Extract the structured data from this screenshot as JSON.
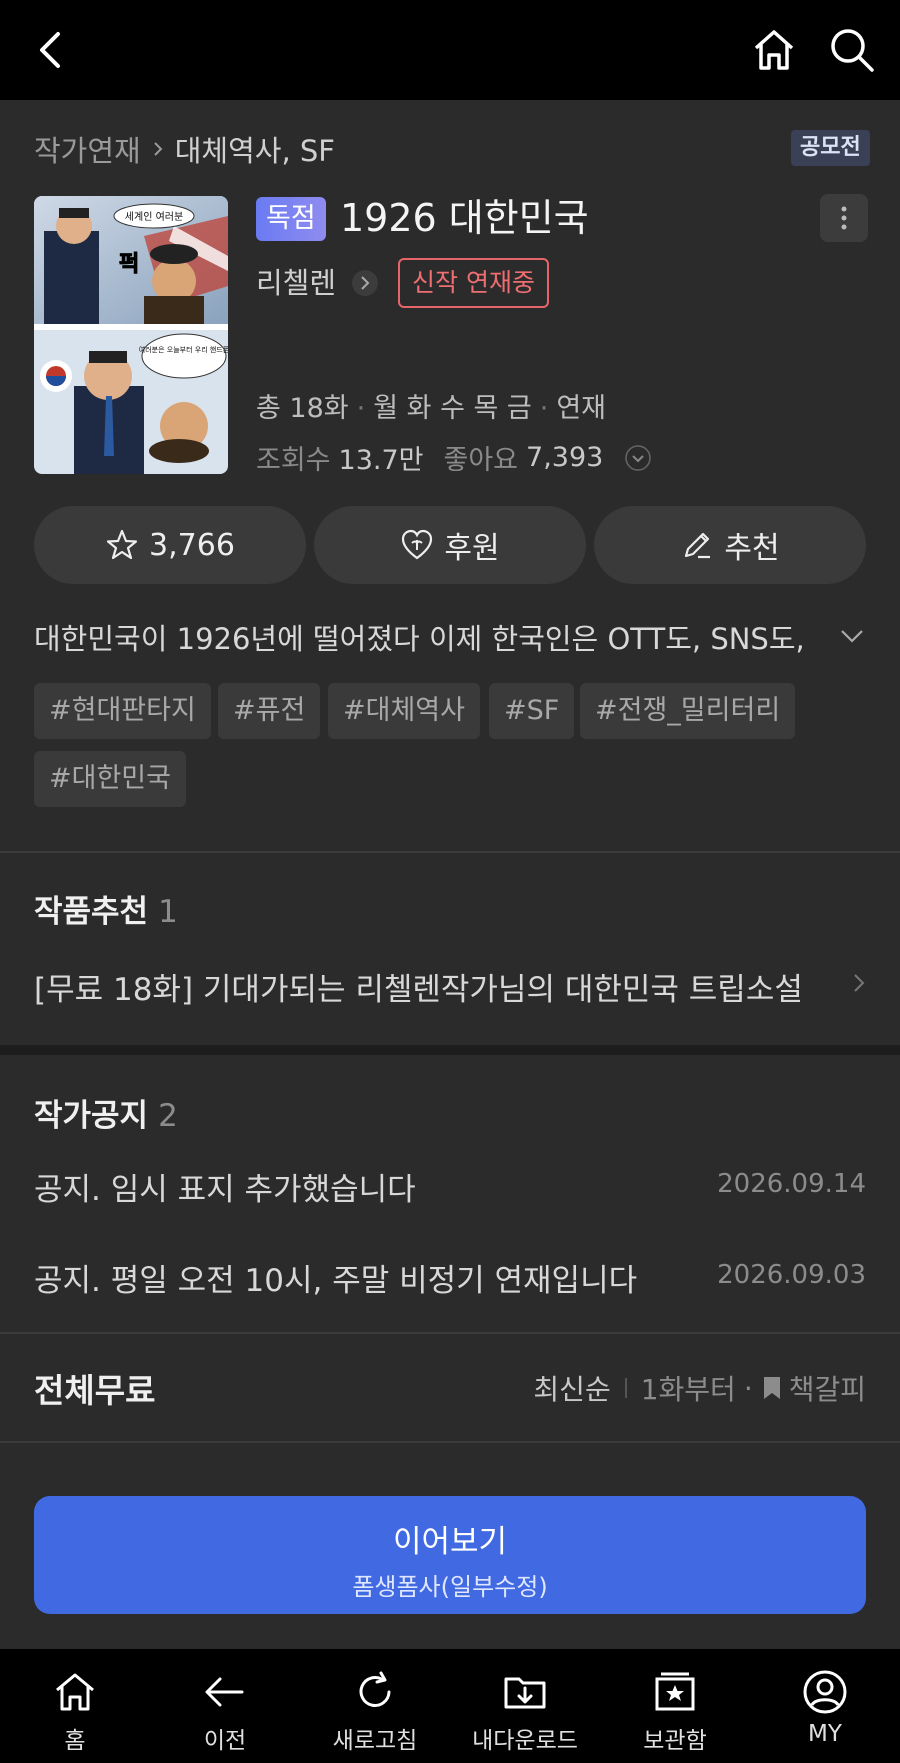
{
  "breadcrumb": {
    "parent": "작가연재",
    "current": "대체역사, SF"
  },
  "contest_badge": "공모전",
  "work": {
    "exclusive_badge": "독점",
    "title": "1926 대한민국",
    "author": "리첼렌",
    "status_tag": "신작 연재중",
    "episodes": "총 18화",
    "schedule": "월 화 수 목 금",
    "serial": "연재",
    "views_label": "조회수",
    "views": "13.7만",
    "likes_label": "좋아요",
    "likes": "7,393"
  },
  "cover_texts": {
    "top_bubble": "세계인 여러분",
    "sfx": "퍽",
    "bottom_bubble": "여러분은 오늘부터 우리 핸드폰 고객이야. 알았어?!"
  },
  "actions": [
    {
      "icon": "star-icon",
      "label": "3,766"
    },
    {
      "icon": "heart-gift-icon",
      "label": "후원"
    },
    {
      "icon": "pencil-icon",
      "label": "추천"
    }
  ],
  "description": "대한민국이 1926년에 떨어졌다 이제 한국인은 OTT도, SNS도, …",
  "tags": [
    "#현대판타지",
    "#퓨전",
    "#대체역사",
    "#SF",
    "#전쟁_밀리터리",
    "#대한민국"
  ],
  "recommend": {
    "title": "작품추천",
    "count": "1",
    "item": "[무료 18화] 기대가되는 리첼렌작가님의 대한민국 트립소설"
  },
  "notices": {
    "title": "작가공지",
    "count": "2",
    "items": [
      {
        "text": "공지. 임시 표지 추가했습니다",
        "date": "2026.09.14"
      },
      {
        "text": "공지. 평일 오전 10시, 주말 비정기 연재입니다",
        "date": "2026.09.03"
      }
    ]
  },
  "episodes_header": {
    "title": "전체무료",
    "sort_latest": "최신순",
    "sort_first": "1화부터",
    "bookmark": "책갈피"
  },
  "cta": {
    "main": "이어보기",
    "sub": "폼생폼사(일부수정)"
  },
  "bottom_nav": [
    {
      "icon": "home-icon",
      "label": "홈"
    },
    {
      "icon": "arrow-left-icon",
      "label": "이전"
    },
    {
      "icon": "refresh-icon",
      "label": "새로고침"
    },
    {
      "icon": "download-folder-icon",
      "label": "내다운로드"
    },
    {
      "icon": "bookshelf-icon",
      "label": "보관함"
    },
    {
      "icon": "profile-icon",
      "label": "MY"
    }
  ],
  "colors": {
    "accent": "#4169e1",
    "new_tag": "#ee6e72",
    "background": "#2b2b2b"
  }
}
